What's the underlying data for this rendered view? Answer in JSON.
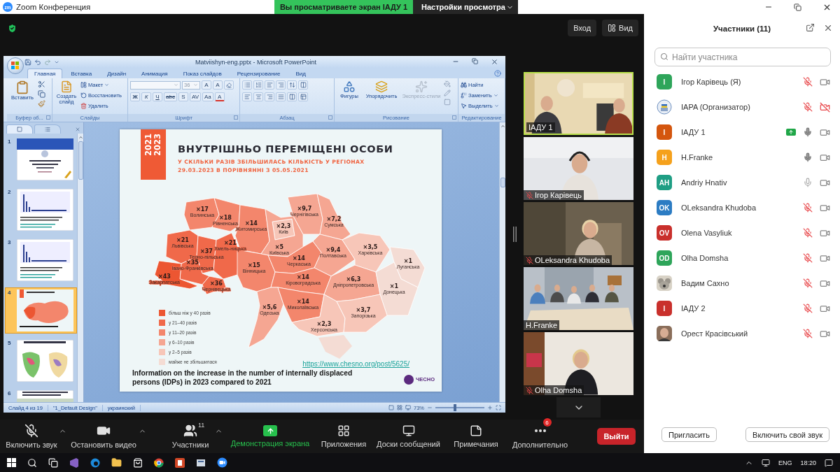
{
  "window": {
    "logo": "zm",
    "title": "Zoom Конференция"
  },
  "share_banner": {
    "status": "Вы просматриваете экран ІАДУ 1",
    "options": "Настройки просмотра"
  },
  "top_controls": {
    "sign_in": "Вход",
    "view": "Вид"
  },
  "presentation": {
    "title": "Matviishyn-eng.pptx - Microsoft PowerPoint",
    "tabs": [
      {
        "label": "Главная",
        "selected": true
      },
      {
        "label": "Вставка",
        "selected": false
      },
      {
        "label": "Дизайн",
        "selected": false
      },
      {
        "label": "Анимация",
        "selected": false
      },
      {
        "label": "Показ слайдов",
        "selected": false
      },
      {
        "label": "Рецензирование",
        "selected": false
      },
      {
        "label": "Вид",
        "selected": false
      }
    ],
    "ribbon": {
      "clipboard": {
        "paste": "Вставить",
        "label": "Буфер об..."
      },
      "slides": {
        "new_slide": "Создать слайд",
        "layout": "Макет",
        "reset": "Восстановить",
        "delete": "Удалить",
        "label": "Слайды"
      },
      "font": {
        "size": "36",
        "size_buttons": [
          "A",
          "A"
        ],
        "buttons": [
          "Ж",
          "К",
          "Ч",
          "abc",
          "S",
          "AV",
          "Aa",
          "A"
        ],
        "label": "Шрифт"
      },
      "paragraph": {
        "label": "Абзац"
      },
      "drawing": {
        "shapes": "Фигуры",
        "arrange": "Упорядочить",
        "quick_styles": "Экспресс-стили",
        "quick_styles_disabled": true,
        "label": "Рисование"
      },
      "editing": {
        "find": "Найти",
        "replace": "Заменить",
        "select": "Выделить",
        "label": "Редактирование"
      }
    },
    "thumbnails": [
      {
        "number": "1",
        "kind": "title",
        "selected": false
      },
      {
        "number": "2",
        "kind": "chart",
        "selected": false
      },
      {
        "number": "3",
        "kind": "chart",
        "selected": false
      },
      {
        "number": "4",
        "kind": "map",
        "selected": true
      },
      {
        "number": "5",
        "kind": "maps",
        "selected": false
      },
      {
        "number": "6",
        "selected": false
      }
    ],
    "slide": {
      "years": [
        "2021",
        "2023"
      ],
      "title": "ВНУТРІШНЬО ПЕРЕМІЩЕНІ ОСОБИ",
      "subtitle": [
        "У СКІЛЬКИ РАЗІВ ЗБІЛЬШИЛАСЬ КІЛЬКІСТЬ У РЕГІОНАХ",
        "29.03.2023 В ПОРІВНЯННІ З 05.05.2021"
      ],
      "regions": [
        {
          "value": "×17",
          "name": "Волинська",
          "color": "#f3866c"
        },
        {
          "value": "×18",
          "name": "Рівненська",
          "color": "#f3866c"
        },
        {
          "value": "×14",
          "name": "Житомирська",
          "color": "#f3866c"
        },
        {
          "value": "×2,3",
          "name": "Київ",
          "color": "#f7c6b8"
        },
        {
          "value": "×5",
          "name": "Київська",
          "color": "#f5a692"
        },
        {
          "value": "×9,7",
          "name": "Чернігівська",
          "color": "#f5a692"
        },
        {
          "value": "×7,2",
          "name": "Сумська",
          "color": "#f5a692"
        },
        {
          "value": "×21",
          "name": "Львівська",
          "color": "#f0694a"
        },
        {
          "value": "×37",
          "name": "Терно-пільська",
          "color": "#f0694a"
        },
        {
          "value": "×21",
          "name": "Хмель-ницька",
          "color": "#f0694a"
        },
        {
          "value": "×35",
          "name": "Івано-Франківська",
          "color": "#f0694a"
        },
        {
          "value": "×43",
          "name": "Закарпатська",
          "color": "#ec5632"
        },
        {
          "value": "×36",
          "name": "Чернівецька",
          "color": "#f0694a"
        },
        {
          "value": "×15",
          "name": "Вінницька",
          "color": "#f3866c"
        },
        {
          "value": "×14",
          "name": "Черкаська",
          "color": "#f3866c"
        },
        {
          "value": "×9,4",
          "name": "Полтавська",
          "color": "#f5a692"
        },
        {
          "value": "×3,5",
          "name": "Харківська",
          "color": "#f7c6b8"
        },
        {
          "value": "×1",
          "name": "Луганська",
          "color": "#f4dcd4"
        },
        {
          "value": "×14",
          "name": "Кіровоградська",
          "color": "#f3866c"
        },
        {
          "value": "×6,3",
          "name": "Дніпропетровська",
          "color": "#f5a692"
        },
        {
          "value": "×1",
          "name": "Донецька",
          "color": "#f4dcd4"
        },
        {
          "value": "×5,6",
          "name": "Одеська",
          "color": "#f5a692"
        },
        {
          "value": "×14",
          "name": "Миколаївська",
          "color": "#f3866c"
        },
        {
          "value": "×2,3",
          "name": "Херсонська",
          "color": "#f7c6b8"
        },
        {
          "value": "×3,7",
          "name": "Запорізька",
          "color": "#f7c6b8"
        }
      ],
      "legend": [
        {
          "label": "більш ніж у 40 разів",
          "color": "#ec5632"
        },
        {
          "label": "у 21–40 разів",
          "color": "#f0694a"
        },
        {
          "label": "у 11–20 разів",
          "color": "#f3866c"
        },
        {
          "label": "у 6–10 разів",
          "color": "#f5a692"
        },
        {
          "label": "у 2–5 разів",
          "color": "#f7c6b8"
        },
        {
          "label": "майже не збільшилася",
          "color": "#f4dcd4"
        }
      ],
      "link": "https://www.chesno.org/post/5625/",
      "caption": "Information on the increase in the number of internally displaced persons (IDPs) in 2023 compared to 2021",
      "logo": "ЧЕСНО"
    },
    "status_bar": {
      "slide": "Слайд 4 из 19",
      "theme": "\"1_Default Design\"",
      "language": "украинский",
      "zoom": "73%",
      "level": 0.4
    }
  },
  "video_tiles": [
    {
      "name": "ІАДУ 1",
      "active": true,
      "muted": false
    },
    {
      "name": "Ігор Карівець",
      "active": false,
      "muted": true
    },
    {
      "name": "OLeksandra Khudoba",
      "active": false,
      "muted": true
    },
    {
      "name": "H.Franke",
      "active": false,
      "muted": false
    },
    {
      "name": "Olha Domsha",
      "active": false,
      "muted": true
    }
  ],
  "toolbar": {
    "items": [
      {
        "kind": "audio",
        "label": "Включить звук",
        "muted": true,
        "caret": true
      },
      {
        "kind": "video",
        "label": "Остановить видео",
        "caret": true
      },
      {
        "kind": "participants",
        "label": "Участники",
        "count": "11",
        "caret": true
      },
      {
        "kind": "share",
        "label": "Демонстрация экрана"
      },
      {
        "kind": "apps",
        "label": "Приложения"
      },
      {
        "kind": "whiteboards",
        "label": "Доски сообщений"
      },
      {
        "kind": "notes",
        "label": "Примечания"
      },
      {
        "kind": "more",
        "label": "Дополнительно",
        "badge": "6"
      }
    ],
    "leave": "Выйти"
  },
  "participants": {
    "title": "Участники (11)",
    "search_placeholder": "Найти участника",
    "items": [
      {
        "name": "Ігор Карівець (Я)",
        "avatar": {
          "kind": "initials",
          "text": "I",
          "color": "#2ea55a"
        },
        "sharing": false,
        "muted": true,
        "video": true
      },
      {
        "name": "IAPA (Организатор)",
        "sharing": false,
        "muted": true,
        "video": false
      },
      {
        "name": "ІАДУ 1",
        "avatar": {
          "kind": "initials",
          "text": "I",
          "color": "#d4560e"
        },
        "sharing": true,
        "muted": false,
        "audio_active": true,
        "video": true
      },
      {
        "name": "H.Franke",
        "avatar": {
          "kind": "initials",
          "text": "H",
          "color": "#f5a11c"
        },
        "sharing": false,
        "muted": false,
        "audio_active": true,
        "video": true
      },
      {
        "name": "Andriy Hnativ",
        "avatar": {
          "kind": "initials",
          "text": "AH",
          "color": "#1f9e84"
        },
        "sharing": false,
        "muted": false,
        "audio_active": false,
        "video": true
      },
      {
        "name": "OLeksandra Khudoba",
        "avatar": {
          "kind": "initials",
          "text": "OK",
          "color": "#2c7cc3"
        },
        "sharing": false,
        "muted": true,
        "video": true
      },
      {
        "name": "Olena Vasyliuk",
        "avatar": {
          "kind": "initials",
          "text": "OV",
          "color": "#c9302c"
        },
        "sharing": false,
        "muted": true,
        "video": true
      },
      {
        "name": "Olha Domsha",
        "avatar": {
          "kind": "initials",
          "text": "OD",
          "color": "#2ea55a"
        },
        "sharing": false,
        "muted": true,
        "video": true
      },
      {
        "name": "Вадим Сахно",
        "sharing": false,
        "muted": true,
        "video": true
      },
      {
        "name": "ІАДУ 2",
        "avatar": {
          "kind": "initials",
          "text": "I",
          "color": "#c9302c"
        },
        "sharing": false,
        "muted": true,
        "video": true
      },
      {
        "name": "Орест Красівський",
        "sharing": false,
        "muted": true,
        "video": true
      }
    ],
    "invite": "Пригласить",
    "unmute_me": "Включить свой звук"
  },
  "taskbar": {
    "language": "ENG",
    "time": "18:20"
  }
}
